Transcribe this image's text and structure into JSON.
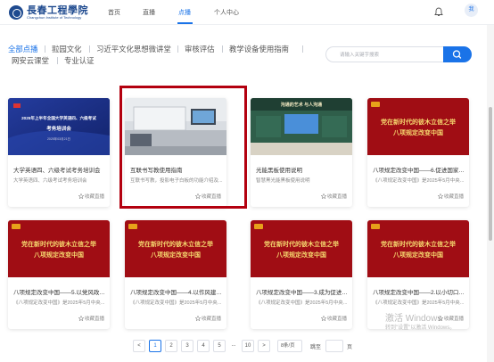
{
  "header": {
    "logo_cn": "長春工程學院",
    "logo_en": "Changchun Institute of Technology",
    "nav": [
      "首页",
      "直播",
      "点播",
      "个人中心"
    ],
    "active_nav": "点播",
    "avatar_text": "我"
  },
  "filters": {
    "categories": [
      "全部点播",
      "翋园文化",
      "习近平文化思想微讲堂",
      "审核评估",
      "教学设备使用指南",
      "网安云课堂",
      "专业认证"
    ],
    "active": "全部点播"
  },
  "search": {
    "placeholder": "请输入关键字搜索"
  },
  "cards": [
    {
      "title": "大学英语四、六级考试考务培训会",
      "desc": "大学英语四、六级考试考务培训会",
      "fav": "收藏直播",
      "thumb": "meeting",
      "thumb_title": "2025年上半年全国大学英语四、六级考试",
      "thumb_sub": "考务培训会",
      "thumb_date": "2025年03月21日"
    },
    {
      "title": "互联书写教使用指南",
      "desc": "互联书写教，投影电子白板的功能介绍及...",
      "fav": "收藏直播",
      "thumb": "classroom"
    },
    {
      "title": "光能黑板使用说明",
      "desc": "智慧黑光能黑板使用说明",
      "fav": "收藏直播",
      "thumb": "blackboard",
      "thumb_banner": "沟通的艺术  与人沟通"
    },
    {
      "title": "八项规定改变中国——6.促进国家治...",
      "desc": "《八项规定改变中国》是2025年5月中央...",
      "fav": "收藏直播",
      "thumb": "red"
    },
    {
      "title": "八项规定改变中国——5.以党风政风...",
      "desc": "《八项规定改变中国》是2025年5月中央...",
      "fav": "收藏直播",
      "thumb": "red"
    },
    {
      "title": "八项规定改变中国——4.以作风建设...",
      "desc": "《八项规定改变中国》是2025年5月中央...",
      "fav": "收藏直播",
      "thumb": "red"
    },
    {
      "title": "八项规定改变中国——3.成为促进高...",
      "desc": "《八项规定改变中国》是2025年5月中央...",
      "fav": "收藏直播",
      "thumb": "red"
    },
    {
      "title": "八项规定改变中国——2.以小切口撬...",
      "desc": "《八项规定改变中国》是2025年5月中央...",
      "fav": "收藏直播",
      "thumb": "red"
    }
  ],
  "red_thumb_text": {
    "line1": "党在新时代的彼木立信之举",
    "line2": "八项规定改变中国"
  },
  "pagination": {
    "prev": "<",
    "next": ">",
    "pages": [
      "1",
      "2",
      "3",
      "4",
      "5",
      "...",
      "10"
    ],
    "current": "1",
    "page_size": "8条/页",
    "goto_label": "跳至",
    "page_label": "页"
  },
  "watermark": {
    "line1": "激活 Windows",
    "line2": "转到\"设置\"以激活 Windows。"
  },
  "colors": {
    "accent": "#1a73e8",
    "highlight": "#b3000f",
    "red_bg": "#a00d14",
    "gold": "#f5d76e"
  }
}
